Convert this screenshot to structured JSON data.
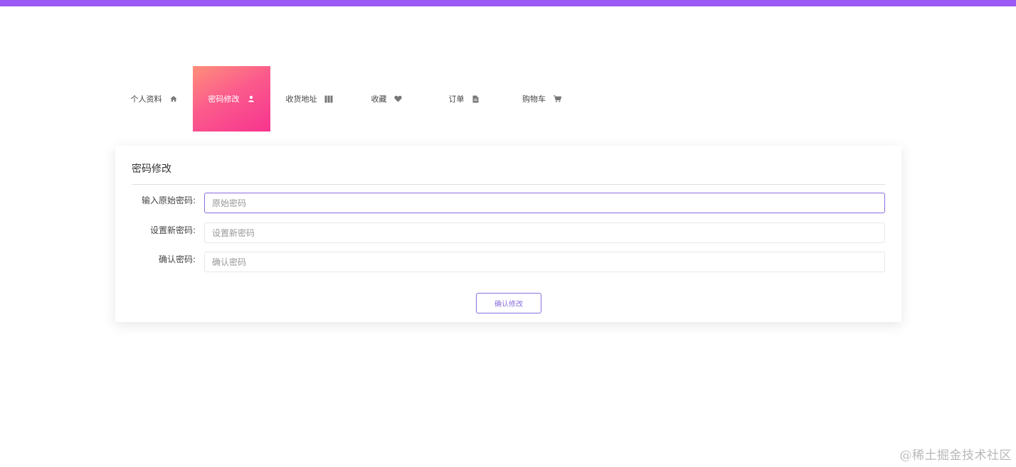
{
  "colors": {
    "accent": "#9b59f6",
    "active_tab_gradient_start": "#ff8f7a",
    "active_tab_gradient_end": "#f7338f",
    "button_border": "#8a6ee0"
  },
  "tabs": [
    {
      "label": "个人资料",
      "icon": "home-icon",
      "active": false
    },
    {
      "label": "密码修改",
      "icon": "user-icon",
      "active": true
    },
    {
      "label": "收货地址",
      "icon": "columns-icon",
      "active": false
    },
    {
      "label": "收藏",
      "icon": "heart-icon",
      "active": false
    },
    {
      "label": "订单",
      "icon": "document-icon",
      "active": false
    },
    {
      "label": "购物车",
      "icon": "cart-icon",
      "active": false
    }
  ],
  "card": {
    "title": "密码修改"
  },
  "form": {
    "old_password": {
      "label": "输入原始密码:",
      "placeholder": "原始密码",
      "value": ""
    },
    "new_password": {
      "label": "设置新密码:",
      "placeholder": "设置新密码",
      "value": ""
    },
    "confirm_password": {
      "label": "确认密码:",
      "placeholder": "确认密码",
      "value": ""
    },
    "submit_label": "确认修改"
  },
  "watermark": "@稀土掘金技术社区"
}
